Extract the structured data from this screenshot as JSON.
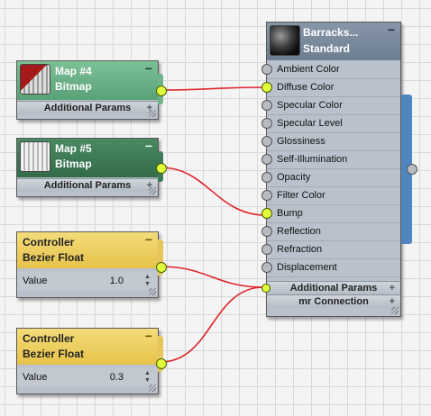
{
  "material": {
    "name": "Barracks...",
    "type": "Standard",
    "slots": [
      {
        "label": "Ambient Color",
        "connected": false
      },
      {
        "label": "Diffuse Color",
        "connected": true
      },
      {
        "label": "Specular Color",
        "connected": false
      },
      {
        "label": "Specular Level",
        "connected": false
      },
      {
        "label": "Glossiness",
        "connected": false
      },
      {
        "label": "Self-Illumination",
        "connected": false
      },
      {
        "label": "Opacity",
        "connected": false
      },
      {
        "label": "Filter Color",
        "connected": false
      },
      {
        "label": "Bump",
        "connected": true
      },
      {
        "label": "Reflection",
        "connected": false
      },
      {
        "label": "Refraction",
        "connected": false
      },
      {
        "label": "Displacement",
        "connected": false
      }
    ],
    "additional_params": "Additional Params",
    "mr_connection": "mr Connection",
    "minimize": "−",
    "plus": "+"
  },
  "map4": {
    "name": "Map #4",
    "type": "Bitmap",
    "additional_params": "Additional Params",
    "minimize": "−",
    "plus": "+"
  },
  "map5": {
    "name": "Map #5",
    "type": "Bitmap",
    "additional_params": "Additional Params",
    "minimize": "−",
    "plus": "+"
  },
  "controller1": {
    "title": "Controller",
    "type": "Bezier Float",
    "value_label": "Value",
    "value": "1.0",
    "minimize": "−"
  },
  "controller2": {
    "title": "Controller",
    "type": "Bezier Float",
    "value_label": "Value",
    "value": "0.3",
    "minimize": "−"
  },
  "colors": {
    "map4_header": "#6fb38a",
    "map5_header": "#3d7a55",
    "controller_header": "#e8c75a",
    "material_header": "#7d8da0",
    "wire": "#e0242a",
    "socket_active": "#dfff3a",
    "tab": "#4f86c0"
  }
}
